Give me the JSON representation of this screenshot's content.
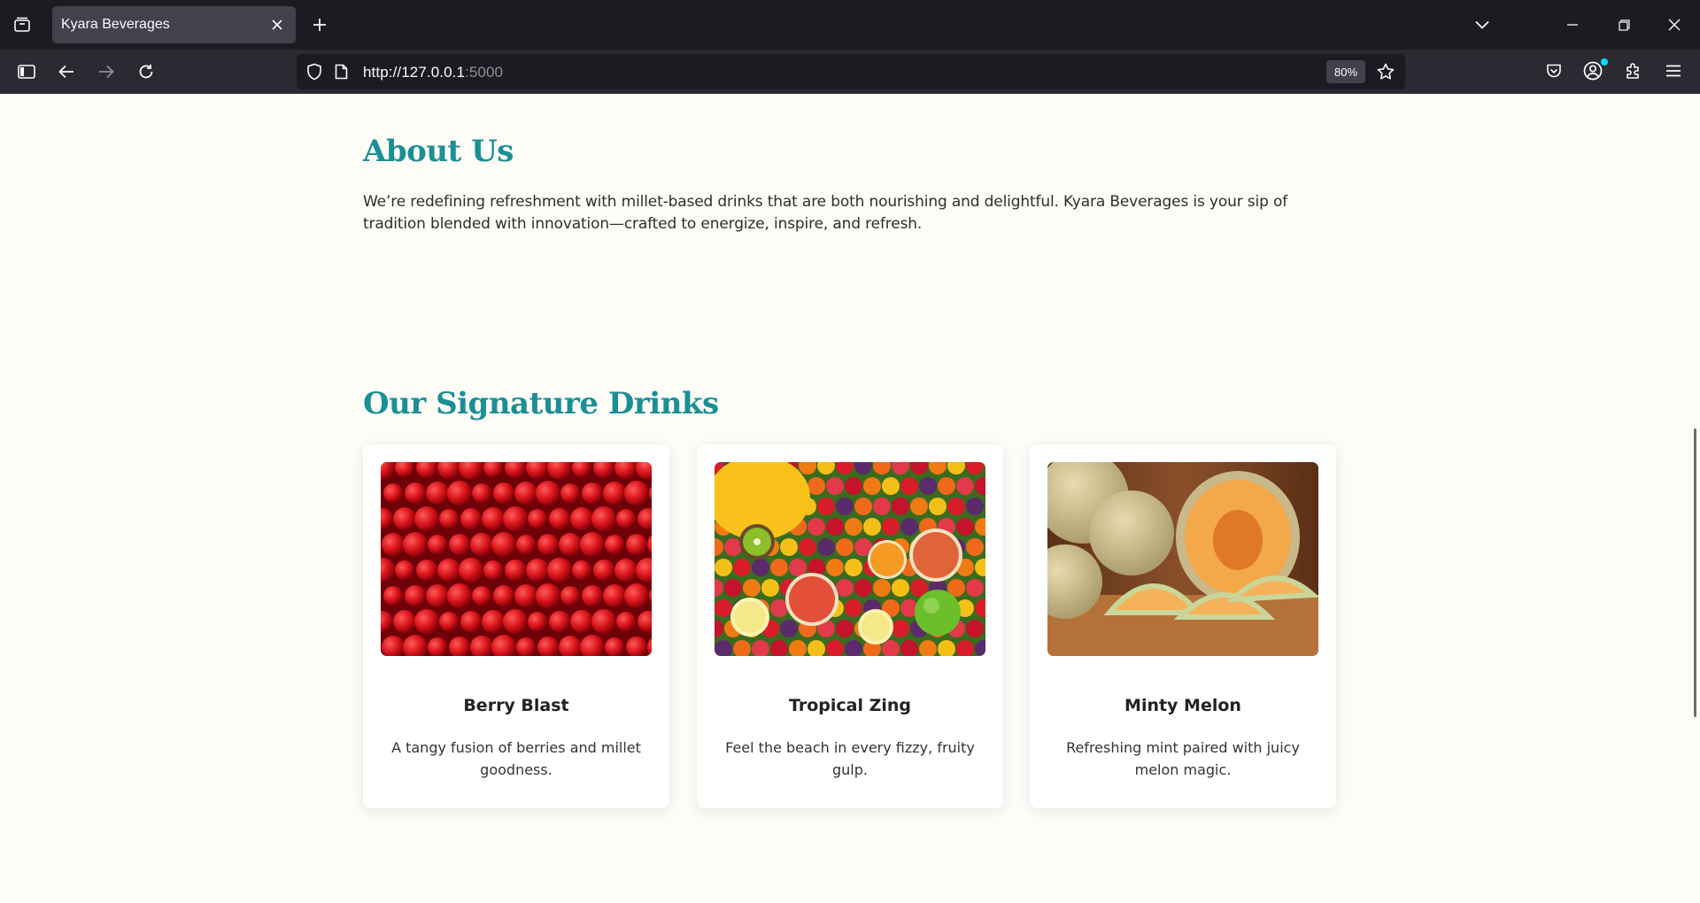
{
  "browser": {
    "tab_title": "Kyara Beverages",
    "url_host": "http://127.0.0.1",
    "url_port": ":5000",
    "zoom": "80%"
  },
  "icons": {
    "tab_overview": "tabs-overview-icon",
    "close_tab": "close-icon",
    "new_tab": "plus-icon",
    "list_tabs": "chevron-down-icon",
    "minimize": "minimize-icon",
    "restore": "restore-icon",
    "close_window": "close-window-icon",
    "sidebar": "sidebar-icon",
    "back": "back-arrow-icon",
    "forward": "forward-arrow-icon",
    "reload": "reload-icon",
    "shield": "shield-icon",
    "page": "page-icon",
    "bookmark": "star-icon",
    "pocket": "pocket-icon",
    "account": "account-icon",
    "extensions": "puzzle-icon",
    "menu": "hamburger-menu-icon"
  },
  "colors": {
    "heading": "#1a8f96",
    "page_bg": "#fdfcf7",
    "chrome_dark": "#1c1b22",
    "toolbar": "#2b2a33"
  },
  "about": {
    "heading": "About Us",
    "text": "We’re redefining refreshment with millet-based drinks that are both nourishing and delightful. Kyara Beverages is your sip of tradition blended with innovation—crafted to energize, inspire, and refresh."
  },
  "drinks": {
    "heading": "Our Signature Drinks",
    "items": [
      {
        "title": "Berry Blast",
        "desc": "A tangy fusion of berries and millet goodness.",
        "image": "red berries photo"
      },
      {
        "title": "Tropical Zing",
        "desc": "Feel the beach in every fizzy, fruity gulp.",
        "image": "mixed tropical fruits photo"
      },
      {
        "title": "Minty Melon",
        "desc": "Refreshing mint paired with juicy melon magic.",
        "image": "cantaloupe melons photo"
      }
    ]
  }
}
